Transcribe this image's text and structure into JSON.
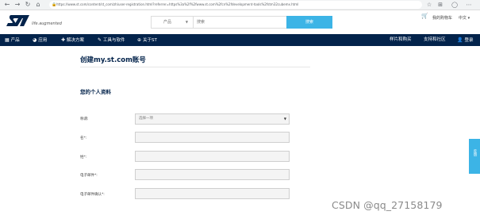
{
  "browser": {
    "url": "https://www.st.com/content/st_com/zh/user-registration.html?referrer=https%3a%2f%2fwww.st.com%2fcn%2fdevelopment-tools%2fstm32cubemx.html",
    "icons": [
      "back-arrow-icon",
      "forward-arrow-icon",
      "reload-icon",
      "home-icon",
      "lock-icon",
      "star-icon",
      "extension-icon",
      "profile-icon",
      "menu-icon"
    ]
  },
  "header": {
    "tagline": "life.augmented",
    "search": {
      "product_label": "产品",
      "placeholder": "搜索",
      "button_label": "搜索"
    },
    "cart_label": "我的购物车",
    "language": "中文"
  },
  "navbar": {
    "items": [
      {
        "label": "产品",
        "icon": "grid-icon"
      },
      {
        "label": "应用",
        "icon": "pie-chart-icon"
      },
      {
        "label": "解决方案",
        "icon": "puzzle-icon"
      },
      {
        "label": "工具与软件",
        "icon": "wrench-icon"
      },
      {
        "label": "关于ST",
        "icon": "globe-icon"
      }
    ],
    "right_items": [
      {
        "label": "样片和购买"
      },
      {
        "label": "支持和社区"
      },
      {
        "label": "登录",
        "icon": "user-icon"
      }
    ]
  },
  "main": {
    "page_title": "创建my.st.com账号",
    "section_title": "您的个人资料",
    "fields": [
      {
        "label": "称谓:",
        "value": "选择一项",
        "type": "select"
      },
      {
        "label": "名*:",
        "value": "",
        "type": "text"
      },
      {
        "label": "姓*:",
        "value": "",
        "type": "text"
      },
      {
        "label": "电子邮件*:",
        "value": "",
        "type": "text"
      },
      {
        "label": "电子邮件确认*:",
        "value": "",
        "type": "text"
      }
    ]
  },
  "feedback_tab": "反馈",
  "watermark": "CSDN @qq_27158179",
  "colors": {
    "brand_dark": "#03234b",
    "brand_accent": "#3cb4e6"
  }
}
